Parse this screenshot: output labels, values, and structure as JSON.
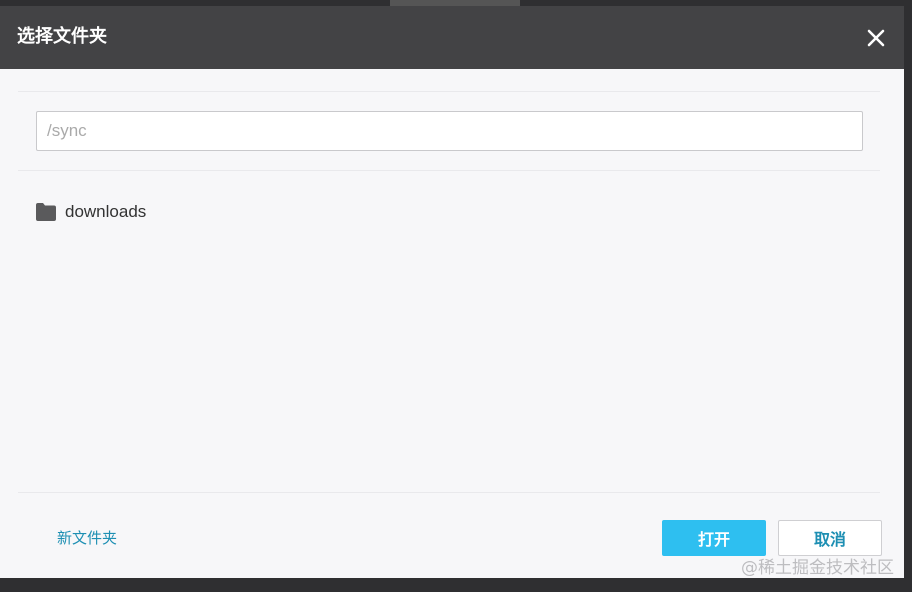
{
  "dialog": {
    "title": "选择文件夹",
    "close_icon": "close-icon"
  },
  "path_input": {
    "value": "",
    "placeholder": "/sync"
  },
  "folders": [
    {
      "name": "downloads",
      "icon": "folder-icon"
    }
  ],
  "footer": {
    "new_folder_label": "新文件夹",
    "open_label": "打开",
    "cancel_label": "取消"
  },
  "watermark": "@稀土掘金技术社区",
  "colors": {
    "header_bg": "#434345",
    "primary": "#2ebff0",
    "link": "#1d8fb3",
    "dialog_bg": "#f7f7f9"
  }
}
